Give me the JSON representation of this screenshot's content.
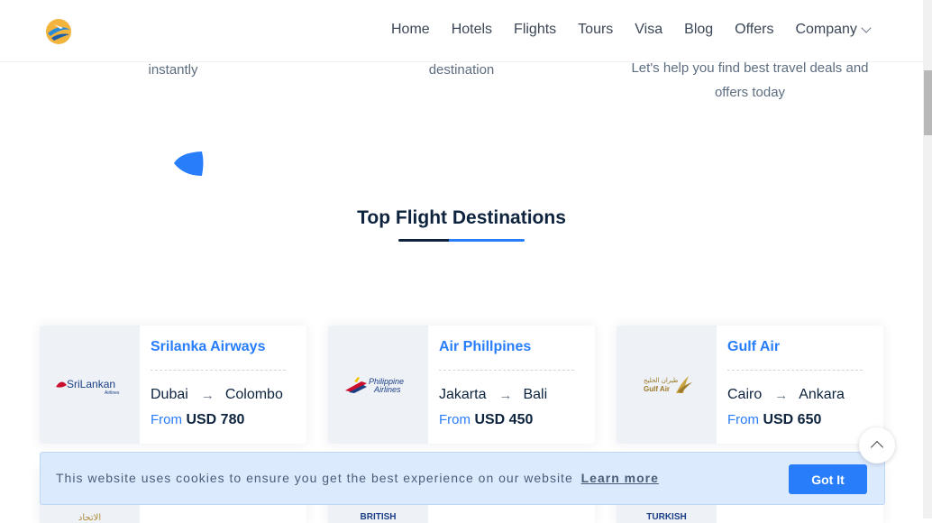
{
  "features": [
    {
      "text": "instantly"
    },
    {
      "text": "destination"
    },
    {
      "text": "Let's help you find best travel deals and offers today"
    }
  ],
  "nav": {
    "items": [
      "Home",
      "Hotels",
      "Flights",
      "Tours",
      "Visa",
      "Blog",
      "Offers"
    ],
    "company": "Company"
  },
  "section": {
    "title": "Top Flight Destinations"
  },
  "cards": [
    {
      "airline": "Srilanka Airways",
      "from_city": "Dubai",
      "to_city": "Colombo",
      "from_label": "From",
      "price": "USD 780",
      "logo_text": "SriLankan",
      "logo_sub": "Airlines"
    },
    {
      "airline": "Air Phillpines",
      "from_city": "Jakarta",
      "to_city": "Bali",
      "from_label": "From",
      "price": "USD 450",
      "logo_text": "Philippine",
      "logo_sub": "Airlines"
    },
    {
      "airline": "Gulf Air",
      "from_city": "Cairo",
      "to_city": "Ankara",
      "from_label": "From",
      "price": "USD 650",
      "logo_text": "Gulf Air",
      "logo_sub": "طيران الخليج"
    }
  ],
  "row2_logos": [
    "الاتحاد",
    "BRITISH",
    "TURKISH"
  ],
  "cookie": {
    "text": "This website uses cookies to ensure you get the best experience on our website",
    "link": "Learn more",
    "button": "Got It"
  },
  "colors": {
    "accent": "#287dfa",
    "navy": "#0d233e"
  }
}
